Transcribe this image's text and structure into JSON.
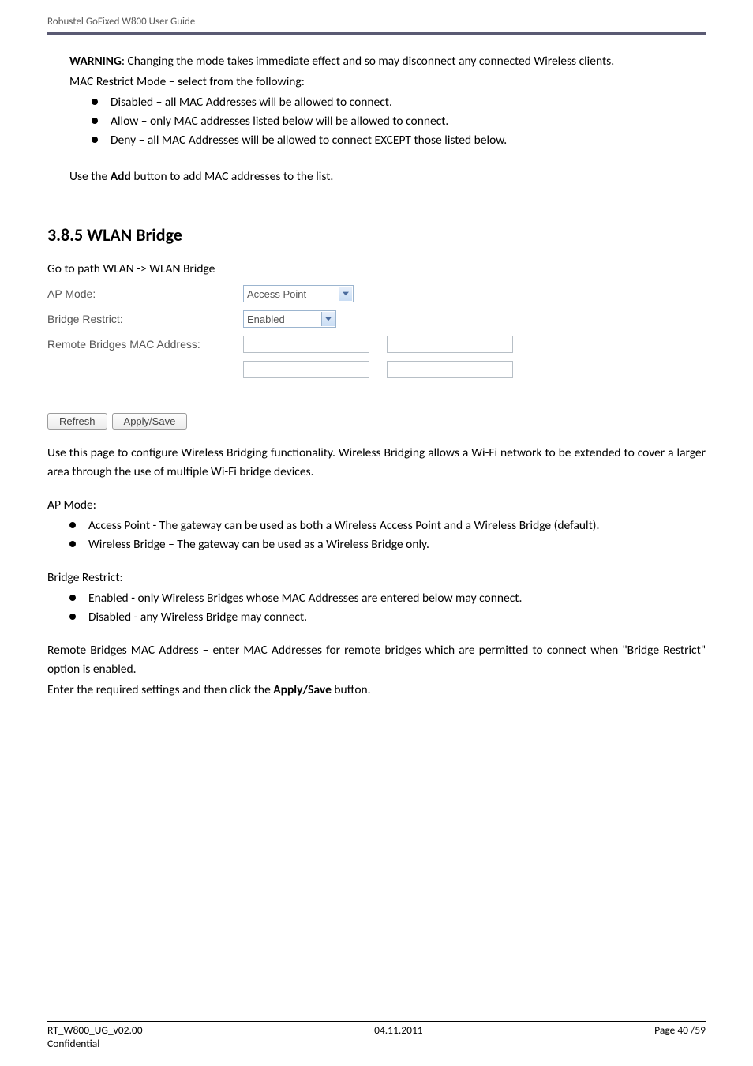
{
  "header": {
    "running_title": "Robustel GoFixed W800 User Guide"
  },
  "intro": {
    "warning_label": "WARNING",
    "warning_text": ": Changing the mode takes immediate effect and so may disconnect any connected Wireless clients.",
    "mac_restrict_intro": "MAC Restrict Mode – select from the following:",
    "mac_restrict_items": [
      "Disabled – all MAC Addresses will be allowed to connect.",
      "Allow – only MAC addresses listed below will be allowed to connect.",
      "Deny – all MAC Addresses will be allowed to connect EXCEPT those listed below."
    ],
    "use_add_pre": "Use the ",
    "use_add_bold": "Add",
    "use_add_post": " button to add MAC addresses to the list."
  },
  "section": {
    "heading": "3.8.5 WLAN Bridge",
    "path": "Go to path WLAN -> WLAN Bridge"
  },
  "form": {
    "ap_mode_label": "AP Mode:",
    "ap_mode_value": "Access Point",
    "bridge_restrict_label": "Bridge Restrict:",
    "bridge_restrict_value": "Enabled",
    "remote_mac_label": "Remote Bridges MAC Address:"
  },
  "buttons": {
    "refresh": "Refresh",
    "apply_save": "Apply/Save"
  },
  "description": {
    "para": "Use this page to configure Wireless Bridging functionality. Wireless Bridging allows a Wi-Fi network to be extended to cover a larger area through the use of multiple Wi-Fi bridge devices.",
    "ap_mode_heading": "AP Mode:",
    "ap_mode_items": [
      "Access Point - The gateway can be used as both a Wireless Access Point and a Wireless Bridge (default).",
      "Wireless Bridge – The gateway can be used as a Wireless Bridge only."
    ],
    "bridge_restrict_heading": "Bridge Restrict:",
    "bridge_restrict_items": [
      "Enabled - only Wireless Bridges whose MAC Addresses are entered below may connect.",
      "Disabled - any Wireless Bridge may connect."
    ],
    "remote_mac_text": "Remote Bridges MAC Address – enter MAC Addresses for remote bridges which are permitted to connect when \"Bridge Restrict\" option is enabled.",
    "enter_pre": "Enter the required settings and then click the ",
    "enter_bold": "Apply/Save",
    "enter_post": " button."
  },
  "footer": {
    "doc_id": "RT_W800_UG_v02.00",
    "date": "04.11.2011",
    "page_label": "Page 40 /59",
    "confidential": "Confidential"
  }
}
